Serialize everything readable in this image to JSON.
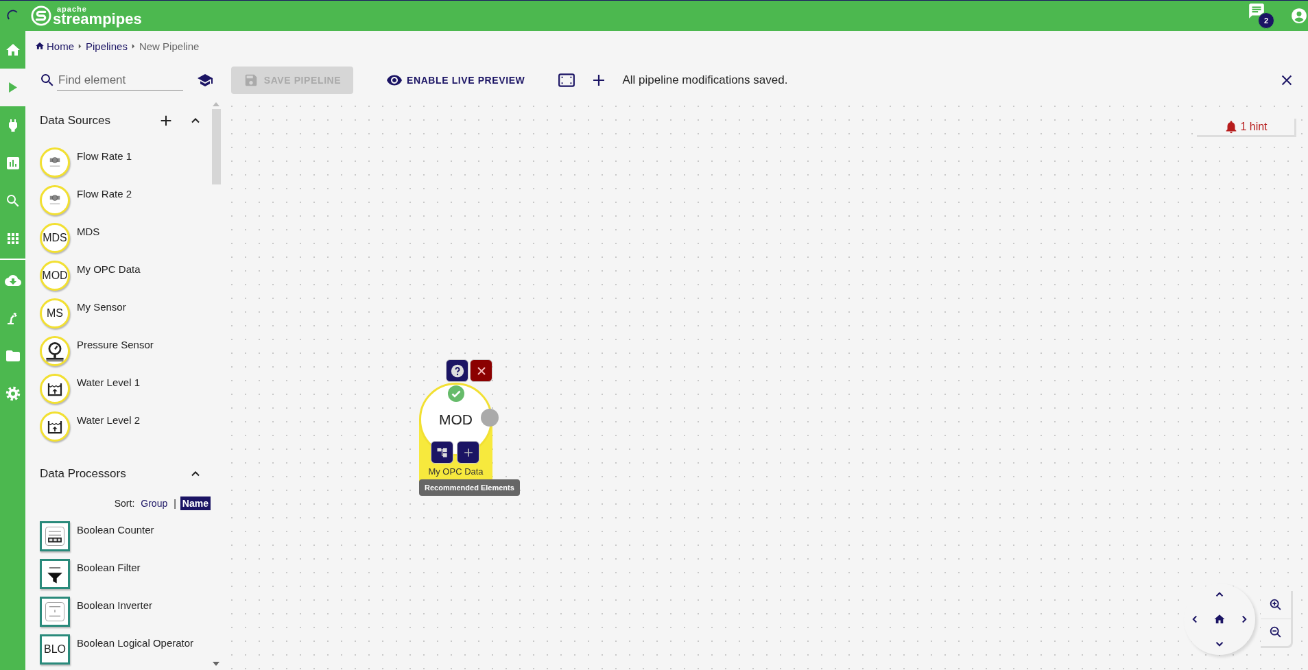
{
  "header": {
    "logo_top": "apache",
    "logo_name": "streampipes",
    "notification_count": "2"
  },
  "nav_groups": [
    [
      {
        "kind": "home",
        "selected": false
      },
      {
        "kind": "pipelines",
        "selected": true
      },
      {
        "kind": "connect",
        "selected": false
      },
      {
        "kind": "dashboard",
        "selected": false
      },
      {
        "kind": "explorer",
        "selected": false
      },
      {
        "kind": "apps",
        "selected": false
      }
    ],
    [
      {
        "kind": "install",
        "selected": false
      },
      {
        "kind": "assets",
        "selected": false
      },
      {
        "kind": "files",
        "selected": false
      },
      {
        "kind": "settings",
        "selected": false
      }
    ]
  ],
  "breadcrumb": [
    {
      "label": "Home",
      "kind": "home",
      "current": false
    },
    {
      "label": "Pipelines",
      "kind": "link",
      "current": false
    },
    {
      "label": "New Pipeline",
      "kind": "link",
      "current": true
    }
  ],
  "toolbar": {
    "search_placeholder": "Find element",
    "save_button": {
      "label": "SAVE PIPELINE",
      "disabled": true
    },
    "preview_button": "ENABLE LIVE PREVIEW",
    "status": "All pipeline modifications saved."
  },
  "sections": [
    {
      "title": "Data Sources",
      "kind": "sources",
      "can_add": true,
      "expanded": true,
      "items": [
        {
          "name": "Flow Rate 1",
          "kind": "flow"
        },
        {
          "name": "Flow Rate 2",
          "kind": "flow"
        },
        {
          "name": "MDS",
          "kind": "abbrev",
          "abbrev": "MDS"
        },
        {
          "name": "My OPC Data",
          "kind": "abbrev",
          "abbrev": "MOD"
        },
        {
          "name": "My Sensor",
          "kind": "abbrev",
          "abbrev": "MS"
        },
        {
          "name": "Pressure Sensor",
          "kind": "gauge"
        },
        {
          "name": "Water Level 1",
          "kind": "tank"
        },
        {
          "name": "Water Level 2",
          "kind": "tank"
        }
      ]
    },
    {
      "title": "Data Processors",
      "kind": "processors",
      "can_add": false,
      "expanded": true,
      "sort": {
        "label": "Sort:",
        "separator": "|",
        "options": [
          {
            "label": "Group",
            "selected": false
          },
          {
            "label": "Name",
            "selected": true
          }
        ]
      },
      "items": [
        {
          "name": "Boolean Counter",
          "kind": "counter"
        },
        {
          "name": "Boolean Filter",
          "kind": "funnel"
        },
        {
          "name": "Boolean Inverter",
          "kind": "inverter"
        },
        {
          "name": "Boolean Logical Operator",
          "kind": "abbrev",
          "abbrev": "BLO"
        }
      ]
    }
  ],
  "canvas": {
    "hint": "1 hint",
    "node": {
      "abbrev": "MOD",
      "label": "My OPC Data",
      "valid": true,
      "tooltip": "Recommended Elements"
    }
  }
}
